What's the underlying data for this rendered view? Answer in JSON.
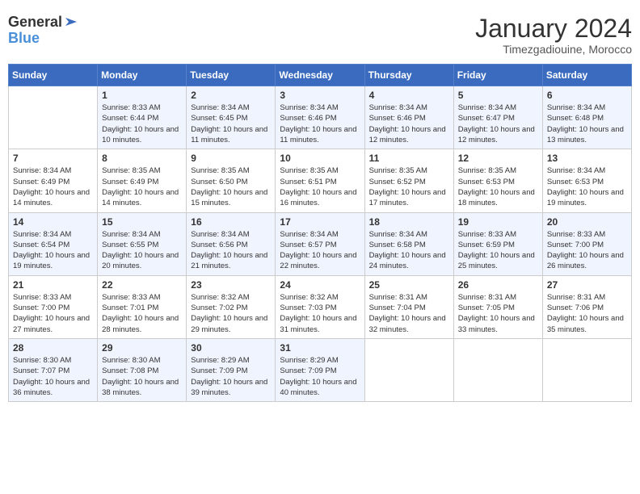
{
  "header": {
    "logo_general": "General",
    "logo_blue": "Blue",
    "title": "January 2024",
    "subtitle": "Timezgadiouine, Morocco"
  },
  "days_of_week": [
    "Sunday",
    "Monday",
    "Tuesday",
    "Wednesday",
    "Thursday",
    "Friday",
    "Saturday"
  ],
  "weeks": [
    [
      {
        "day": "",
        "sunrise": "",
        "sunset": "",
        "daylight": ""
      },
      {
        "day": "1",
        "sunrise": "Sunrise: 8:33 AM",
        "sunset": "Sunset: 6:44 PM",
        "daylight": "Daylight: 10 hours and 10 minutes."
      },
      {
        "day": "2",
        "sunrise": "Sunrise: 8:34 AM",
        "sunset": "Sunset: 6:45 PM",
        "daylight": "Daylight: 10 hours and 11 minutes."
      },
      {
        "day": "3",
        "sunrise": "Sunrise: 8:34 AM",
        "sunset": "Sunset: 6:46 PM",
        "daylight": "Daylight: 10 hours and 11 minutes."
      },
      {
        "day": "4",
        "sunrise": "Sunrise: 8:34 AM",
        "sunset": "Sunset: 6:46 PM",
        "daylight": "Daylight: 10 hours and 12 minutes."
      },
      {
        "day": "5",
        "sunrise": "Sunrise: 8:34 AM",
        "sunset": "Sunset: 6:47 PM",
        "daylight": "Daylight: 10 hours and 12 minutes."
      },
      {
        "day": "6",
        "sunrise": "Sunrise: 8:34 AM",
        "sunset": "Sunset: 6:48 PM",
        "daylight": "Daylight: 10 hours and 13 minutes."
      }
    ],
    [
      {
        "day": "7",
        "sunrise": "Sunrise: 8:34 AM",
        "sunset": "Sunset: 6:49 PM",
        "daylight": "Daylight: 10 hours and 14 minutes."
      },
      {
        "day": "8",
        "sunrise": "Sunrise: 8:35 AM",
        "sunset": "Sunset: 6:49 PM",
        "daylight": "Daylight: 10 hours and 14 minutes."
      },
      {
        "day": "9",
        "sunrise": "Sunrise: 8:35 AM",
        "sunset": "Sunset: 6:50 PM",
        "daylight": "Daylight: 10 hours and 15 minutes."
      },
      {
        "day": "10",
        "sunrise": "Sunrise: 8:35 AM",
        "sunset": "Sunset: 6:51 PM",
        "daylight": "Daylight: 10 hours and 16 minutes."
      },
      {
        "day": "11",
        "sunrise": "Sunrise: 8:35 AM",
        "sunset": "Sunset: 6:52 PM",
        "daylight": "Daylight: 10 hours and 17 minutes."
      },
      {
        "day": "12",
        "sunrise": "Sunrise: 8:35 AM",
        "sunset": "Sunset: 6:53 PM",
        "daylight": "Daylight: 10 hours and 18 minutes."
      },
      {
        "day": "13",
        "sunrise": "Sunrise: 8:34 AM",
        "sunset": "Sunset: 6:53 PM",
        "daylight": "Daylight: 10 hours and 19 minutes."
      }
    ],
    [
      {
        "day": "14",
        "sunrise": "Sunrise: 8:34 AM",
        "sunset": "Sunset: 6:54 PM",
        "daylight": "Daylight: 10 hours and 19 minutes."
      },
      {
        "day": "15",
        "sunrise": "Sunrise: 8:34 AM",
        "sunset": "Sunset: 6:55 PM",
        "daylight": "Daylight: 10 hours and 20 minutes."
      },
      {
        "day": "16",
        "sunrise": "Sunrise: 8:34 AM",
        "sunset": "Sunset: 6:56 PM",
        "daylight": "Daylight: 10 hours and 21 minutes."
      },
      {
        "day": "17",
        "sunrise": "Sunrise: 8:34 AM",
        "sunset": "Sunset: 6:57 PM",
        "daylight": "Daylight: 10 hours and 22 minutes."
      },
      {
        "day": "18",
        "sunrise": "Sunrise: 8:34 AM",
        "sunset": "Sunset: 6:58 PM",
        "daylight": "Daylight: 10 hours and 24 minutes."
      },
      {
        "day": "19",
        "sunrise": "Sunrise: 8:33 AM",
        "sunset": "Sunset: 6:59 PM",
        "daylight": "Daylight: 10 hours and 25 minutes."
      },
      {
        "day": "20",
        "sunrise": "Sunrise: 8:33 AM",
        "sunset": "Sunset: 7:00 PM",
        "daylight": "Daylight: 10 hours and 26 minutes."
      }
    ],
    [
      {
        "day": "21",
        "sunrise": "Sunrise: 8:33 AM",
        "sunset": "Sunset: 7:00 PM",
        "daylight": "Daylight: 10 hours and 27 minutes."
      },
      {
        "day": "22",
        "sunrise": "Sunrise: 8:33 AM",
        "sunset": "Sunset: 7:01 PM",
        "daylight": "Daylight: 10 hours and 28 minutes."
      },
      {
        "day": "23",
        "sunrise": "Sunrise: 8:32 AM",
        "sunset": "Sunset: 7:02 PM",
        "daylight": "Daylight: 10 hours and 29 minutes."
      },
      {
        "day": "24",
        "sunrise": "Sunrise: 8:32 AM",
        "sunset": "Sunset: 7:03 PM",
        "daylight": "Daylight: 10 hours and 31 minutes."
      },
      {
        "day": "25",
        "sunrise": "Sunrise: 8:31 AM",
        "sunset": "Sunset: 7:04 PM",
        "daylight": "Daylight: 10 hours and 32 minutes."
      },
      {
        "day": "26",
        "sunrise": "Sunrise: 8:31 AM",
        "sunset": "Sunset: 7:05 PM",
        "daylight": "Daylight: 10 hours and 33 minutes."
      },
      {
        "day": "27",
        "sunrise": "Sunrise: 8:31 AM",
        "sunset": "Sunset: 7:06 PM",
        "daylight": "Daylight: 10 hours and 35 minutes."
      }
    ],
    [
      {
        "day": "28",
        "sunrise": "Sunrise: 8:30 AM",
        "sunset": "Sunset: 7:07 PM",
        "daylight": "Daylight: 10 hours and 36 minutes."
      },
      {
        "day": "29",
        "sunrise": "Sunrise: 8:30 AM",
        "sunset": "Sunset: 7:08 PM",
        "daylight": "Daylight: 10 hours and 38 minutes."
      },
      {
        "day": "30",
        "sunrise": "Sunrise: 8:29 AM",
        "sunset": "Sunset: 7:09 PM",
        "daylight": "Daylight: 10 hours and 39 minutes."
      },
      {
        "day": "31",
        "sunrise": "Sunrise: 8:29 AM",
        "sunset": "Sunset: 7:09 PM",
        "daylight": "Daylight: 10 hours and 40 minutes."
      },
      {
        "day": "",
        "sunrise": "",
        "sunset": "",
        "daylight": ""
      },
      {
        "day": "",
        "sunrise": "",
        "sunset": "",
        "daylight": ""
      },
      {
        "day": "",
        "sunrise": "",
        "sunset": "",
        "daylight": ""
      }
    ]
  ]
}
